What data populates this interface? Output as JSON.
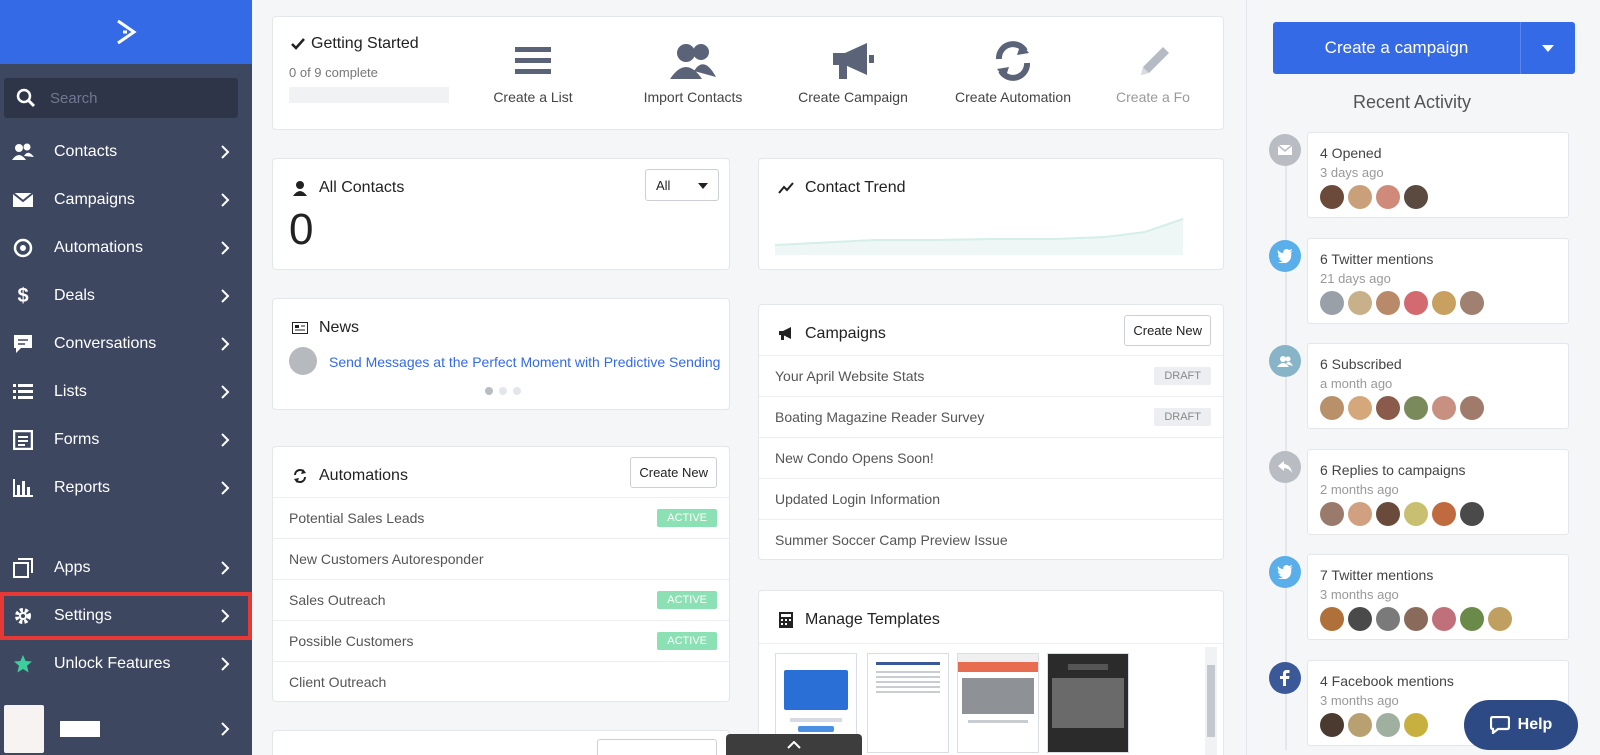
{
  "sidebar": {
    "search_placeholder": "Search",
    "items": [
      {
        "label": "Contacts",
        "icon": "contacts-icon"
      },
      {
        "label": "Campaigns",
        "icon": "envelope-icon"
      },
      {
        "label": "Automations",
        "icon": "automation-icon"
      },
      {
        "label": "Deals",
        "icon": "dollar-icon"
      },
      {
        "label": "Conversations",
        "icon": "chat-icon"
      },
      {
        "label": "Lists",
        "icon": "list-icon"
      },
      {
        "label": "Forms",
        "icon": "form-icon"
      },
      {
        "label": "Reports",
        "icon": "bar-chart-icon"
      },
      {
        "label": "Apps",
        "icon": "apps-icon"
      },
      {
        "label": "Settings",
        "icon": "gear-icon"
      },
      {
        "label": "Unlock Features",
        "icon": "star-icon"
      }
    ],
    "selected": "Settings"
  },
  "getting_started": {
    "title": "Getting Started",
    "progress_text": "0 of 9 complete",
    "progress_fraction": 0,
    "actions": [
      {
        "label": "Create a List",
        "icon": "list-icon"
      },
      {
        "label": "Import Contacts",
        "icon": "users-icon"
      },
      {
        "label": "Create Campaign",
        "icon": "megaphone-icon"
      },
      {
        "label": "Create Automation",
        "icon": "refresh-icon"
      },
      {
        "label": "Create a Fo",
        "icon": "pencil-icon"
      }
    ]
  },
  "all_contacts": {
    "title": "All Contacts",
    "filter": "All",
    "count": "0"
  },
  "contact_trend": {
    "title": "Contact Trend"
  },
  "news": {
    "title": "News",
    "headline": "Send Messages at the Perfect Moment with Predictive Sending"
  },
  "campaigns": {
    "title": "Campaigns",
    "create_label": "Create New",
    "rows": [
      {
        "name": "Your April Website Stats",
        "status": "DRAFT"
      },
      {
        "name": "Boating Magazine Reader Survey",
        "status": "DRAFT"
      },
      {
        "name": "New Condo Opens Soon!",
        "status": ""
      },
      {
        "name": "Updated Login Information",
        "status": ""
      },
      {
        "name": "Summer Soccer Camp Preview Issue",
        "status": ""
      }
    ]
  },
  "automations": {
    "title": "Automations",
    "create_label": "Create New",
    "rows": [
      {
        "name": "Potential Sales Leads",
        "status": "ACTIVE"
      },
      {
        "name": "New Customers Autoresponder",
        "status": ""
      },
      {
        "name": "Sales Outreach",
        "status": "ACTIVE"
      },
      {
        "name": "Possible Customers",
        "status": "ACTIVE"
      },
      {
        "name": "Client Outreach",
        "status": ""
      }
    ]
  },
  "templates": {
    "title": "Manage Templates"
  },
  "right": {
    "create_button": "Create a campaign",
    "recent_title": "Recent Activity",
    "activities": [
      {
        "title": "4 Opened",
        "time": "3 days ago",
        "icon": "envelope-icon",
        "color": "#b9bcc2",
        "avatars": [
          "#6b4a3a",
          "#c9a07a",
          "#d08a7a",
          "#5a4a40"
        ]
      },
      {
        "title": "6 Twitter mentions",
        "time": "21 days ago",
        "icon": "twitter-icon",
        "color": "#5aaeea",
        "avatars": [
          "#9aa0a8",
          "#c7b08a",
          "#b88a6a",
          "#d26a70",
          "#c8a060",
          "#a08070"
        ]
      },
      {
        "title": "6 Subscribed",
        "time": "a month ago",
        "icon": "users-icon",
        "color": "#88b4c8",
        "avatars": [
          "#b8906a",
          "#d4a87a",
          "#8a5a4a",
          "#7a8a5a",
          "#c89080",
          "#a07a6a"
        ]
      },
      {
        "title": "6 Replies to campaigns",
        "time": "2 months ago",
        "icon": "reply-icon",
        "color": "#b9bcc2",
        "avatars": [
          "#9a7a6a",
          "#d0a080",
          "#6a4a3a",
          "#c8c070",
          "#c06a40",
          "#4a4a4a"
        ]
      },
      {
        "title": "7 Twitter mentions",
        "time": "3 months ago",
        "icon": "twitter-icon",
        "color": "#5aaeea",
        "avatars": [
          "#b0703a",
          "#4a4a4a",
          "#7a7a7a",
          "#8a6a5a",
          "#c0707a",
          "#6a8a4a",
          "#c0a060"
        ]
      },
      {
        "title": "4 Facebook mentions",
        "time": "3 months ago",
        "icon": "facebook-icon",
        "color": "#3b5998",
        "avatars": [
          "#4a3a30",
          "#b8a070",
          "#a0b0a0",
          "#c8b040"
        ]
      }
    ],
    "help_label": "Help"
  }
}
